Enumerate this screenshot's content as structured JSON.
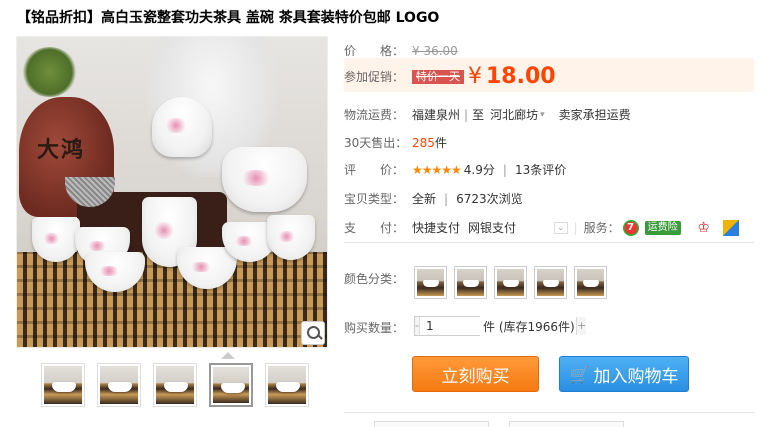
{
  "title": "【铭品折扣】高白玉瓷整套功夫茶具 盖碗 茶具套装特价包邮 LOGO",
  "image": {
    "pot_text": "大鸿"
  },
  "thumbs": {
    "count": 5,
    "selected_index": 3
  },
  "info": {
    "price": {
      "label": "价　　格：",
      "value": "¥ 36.00"
    },
    "promo": {
      "label": "参加促销：",
      "tag": "特价一天",
      "yen": "¥",
      "value": "18.00"
    },
    "shipping": {
      "label": "物流运费：",
      "from": "福建泉州",
      "sep": "至",
      "to": "河北廊坊",
      "note": "卖家承担运费"
    },
    "sold": {
      "label": "30天售出：",
      "count": "285",
      "unit": "件"
    },
    "rating": {
      "label": "评　　价：",
      "stars": "★★★★★",
      "score": "4.9分",
      "reviews": "13条评价"
    },
    "type": {
      "label": "宝贝类型：",
      "condition": "全新",
      "views": "6723次浏览"
    },
    "pay": {
      "label": "支　　付：",
      "method1": "快捷支付",
      "method2": "网银支付",
      "service_label": "服务：",
      "badge": "运费险"
    },
    "color": {
      "label": "颜色分类：",
      "options": 5
    },
    "quantity": {
      "label": "购买数量：",
      "value": "1",
      "minus": "-",
      "plus": "+",
      "note": "件 (库存1966件)"
    },
    "buttons": {
      "buy": "立刻购买",
      "cart": "加入购物车"
    }
  },
  "colors": {
    "accent": "#ff4400",
    "buy": "#f57a12",
    "cart": "#2a8fe3"
  }
}
